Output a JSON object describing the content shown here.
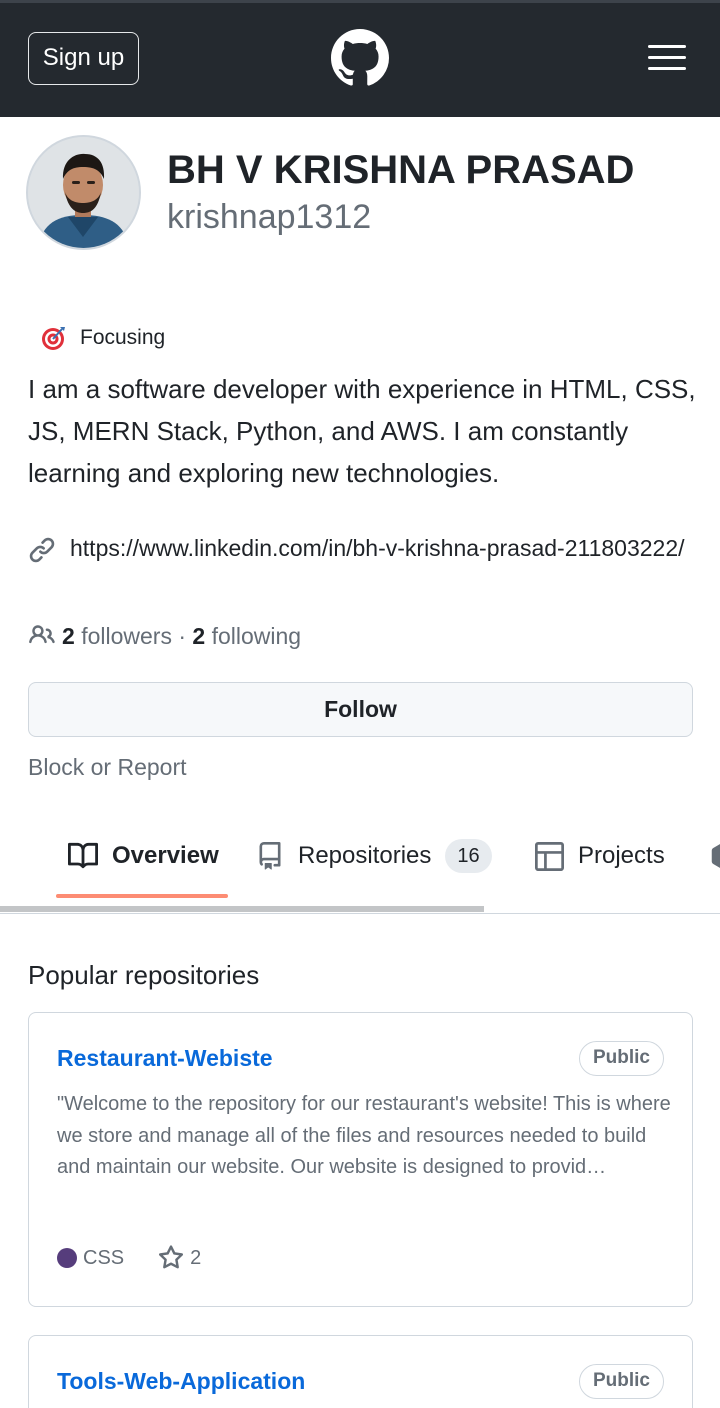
{
  "header": {
    "signup_label": "Sign up",
    "logo_icon": "github-logo-icon",
    "menu_icon": "hamburger-menu-icon"
  },
  "profile": {
    "full_name": "BH V KRISHNA PRASAD",
    "username": "krishnap1312",
    "status_emoji_icon": "target-icon",
    "status_text": "Focusing",
    "bio": "I am a software developer with experience in HTML, CSS, JS, MERN Stack, Python, and AWS. I am constantly learning and exploring new technologies.",
    "link": "https://www.linkedin.com/in/bh-v-krishna-prasad-211803222/",
    "followers_count": "2",
    "followers_label": "followers",
    "separator": "·",
    "following_count": "2",
    "following_label": "following",
    "follow_button": "Follow",
    "block_report": "Block or Report"
  },
  "tabs": [
    {
      "label": "Overview",
      "icon": "book-icon",
      "selected": true
    },
    {
      "label": "Repositories",
      "icon": "repo-icon",
      "count": "16"
    },
    {
      "label": "Projects",
      "icon": "table-icon"
    }
  ],
  "popular": {
    "title": "Popular repositories",
    "repos": [
      {
        "name": "Restaurant-Webiste",
        "visibility": "Public",
        "description": "\"Welcome to the repository for our restaurant's website! This is where we store and manage all of the files and resources needed to build and maintain our website. Our website is designed to provid…",
        "language": "CSS",
        "language_color": "#563d7c",
        "stars": "2"
      },
      {
        "name": "Tools-Web-Application",
        "visibility": "Public"
      }
    ]
  },
  "colors": {
    "header_bg": "#24292f",
    "link_blue": "#0969da",
    "tab_accent": "#fd8c73"
  }
}
